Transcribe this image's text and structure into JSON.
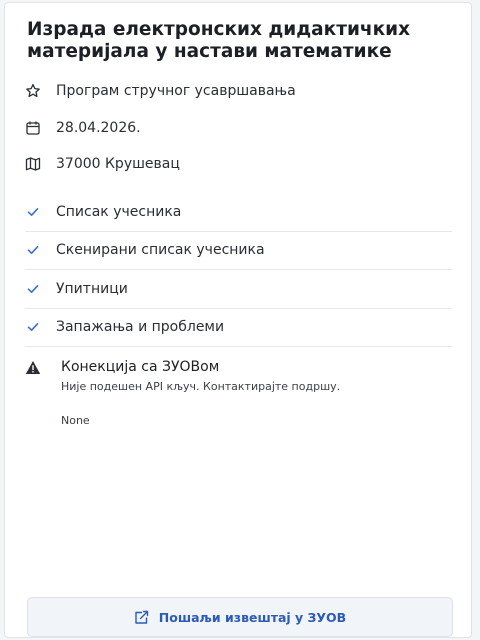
{
  "title": "Израда електронских дидактичких материјала у настави математике",
  "meta": {
    "program": "Програм стручног усавршавања",
    "date": "28.04.2026.",
    "location": "37000 Крушевац"
  },
  "checklist": [
    {
      "label": "Списак учесника",
      "checked": true
    },
    {
      "label": "Скенирани списак учесника",
      "checked": true
    },
    {
      "label": "Упитници",
      "checked": true
    },
    {
      "label": "Запажања и проблеми",
      "checked": true
    }
  ],
  "connection": {
    "title": "Конекција са ЗУОВом",
    "message": "Није подешен API кључ. Контактирајте подршу.",
    "status": "None"
  },
  "actions": {
    "send_report": "Пошаљи извештај у ЗУОВ"
  },
  "colors": {
    "accent": "#2c5ab8",
    "check": "#3b6fd6",
    "text": "#1c1f24"
  }
}
